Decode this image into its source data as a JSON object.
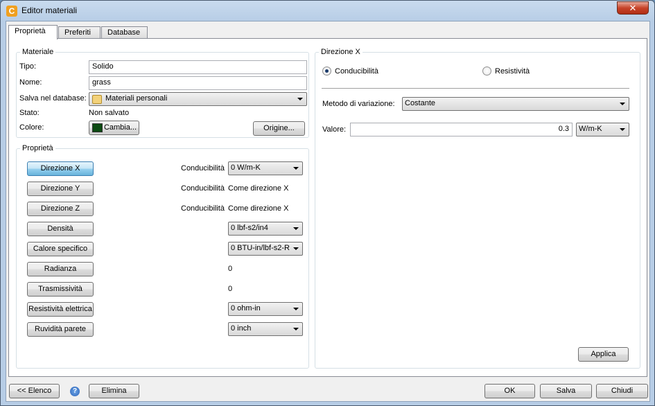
{
  "window": {
    "title": "Editor materiali",
    "close_glyph": "✕"
  },
  "tabs": [
    {
      "label": "Proprietà"
    },
    {
      "label": "Preferiti"
    },
    {
      "label": "Database"
    }
  ],
  "materiale": {
    "title": "Materiale",
    "tipo_label": "Tipo:",
    "tipo_value": "Solido",
    "nome_label": "Nome:",
    "nome_value": "grass",
    "db_label": "Salva nel database:",
    "db_value": "Materiali personali",
    "stato_label": "Stato:",
    "stato_value": "Non salvato",
    "colore_label": "Colore:",
    "cambia_label": "Cambia...",
    "color": "#0c4a12",
    "origine_label": "Origine..."
  },
  "proprieta": {
    "title": "Proprietà",
    "rows": [
      {
        "button": "Direzione X",
        "text_label": "Conducibilità",
        "dropdown": "0 W/m-K"
      },
      {
        "button": "Direzione Y",
        "text_label": "Conducibilità",
        "value": "Come direzione X"
      },
      {
        "button": "Direzione Z",
        "text_label": "Conducibilità",
        "value": "Come direzione X"
      },
      {
        "button": "Densità",
        "dropdown": "0 lbf-s2/in4"
      },
      {
        "button": "Calore specifico",
        "dropdown": "0 BTU-in/lbf-s2-R"
      },
      {
        "button": "Radianza",
        "value": "0"
      },
      {
        "button": "Trasmissività",
        "value": "0"
      },
      {
        "button": "Resistività elettrica",
        "dropdown": "0 ohm-in"
      },
      {
        "button": "Ruvidità parete",
        "dropdown": "0 inch"
      }
    ]
  },
  "direzione": {
    "title": "Direzione X",
    "radio_conducibilita": "Conducibilità",
    "radio_resistivita": "Resistività",
    "metodo_label": "Metodo di variazione:",
    "metodo_value": "Costante",
    "valore_label": "Valore:",
    "valore_value": "0.3",
    "unit_value": "W/m-K",
    "applica_label": "Applica"
  },
  "footer": {
    "elenco_label": "<< Elenco",
    "help_glyph": "?",
    "elimina_label": "Elimina",
    "ok_label": "OK",
    "salva_label": "Salva",
    "chiudi_label": "Chiudi"
  }
}
